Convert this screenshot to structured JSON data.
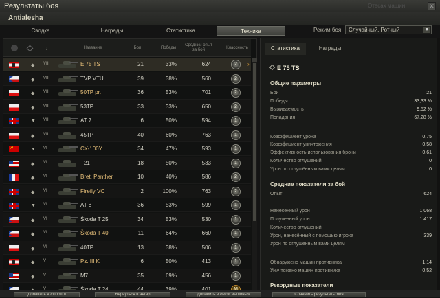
{
  "window": {
    "title": "Результаты боя",
    "close_glyph": "✕",
    "ghost_text": "Отесах машин"
  },
  "user": {
    "name": "Antialesha"
  },
  "tabs": [
    {
      "label": "Сводка"
    },
    {
      "label": "Награды"
    },
    {
      "label": "Статистика"
    },
    {
      "label": "Техника",
      "active": true
    }
  ],
  "mode": {
    "label": "Режим боя:",
    "value": "Случайный, Ротный",
    "arrow": "▼"
  },
  "table": {
    "headers": {
      "name": "Название",
      "battles": "Бои",
      "wins": "Победы",
      "avg_exp": "Средний опыт за бой",
      "mastery": "Классность"
    },
    "rows": [
      {
        "flag": "de",
        "cls": "◆",
        "tier": "VIII",
        "name": "E 75 TS",
        "gold": true,
        "battles": "21",
        "wins": "33%",
        "exp": "624",
        "mastery": "2",
        "mclass": "",
        "selected": true
      },
      {
        "flag": "cz",
        "cls": "◆",
        "tier": "VIII",
        "name": "TVP VTU",
        "gold": false,
        "battles": "39",
        "wins": "38%",
        "exp": "560",
        "mastery": "2",
        "mclass": ""
      },
      {
        "flag": "pl",
        "cls": "◆",
        "tier": "VIII",
        "name": "50TP pr.",
        "gold": true,
        "battles": "36",
        "wins": "53%",
        "exp": "701",
        "mastery": "2",
        "mclass": ""
      },
      {
        "flag": "pl",
        "cls": "◆",
        "tier": "VIII",
        "name": "53TP",
        "gold": false,
        "battles": "33",
        "wins": "33%",
        "exp": "650",
        "mastery": "2",
        "mclass": ""
      },
      {
        "flag": "gb",
        "cls": "▼",
        "tier": "VIII",
        "name": "AT 7",
        "gold": false,
        "battles": "6",
        "wins": "50%",
        "exp": "594",
        "mastery": "1",
        "mclass": ""
      },
      {
        "flag": "pl",
        "cls": "◆",
        "tier": "VII",
        "name": "45TP",
        "gold": false,
        "battles": "40",
        "wins": "60%",
        "exp": "763",
        "mastery": "1",
        "mclass": ""
      },
      {
        "flag": "su",
        "cls": "▼",
        "tier": "VI",
        "name": "СУ-100Y",
        "gold": true,
        "battles": "34",
        "wins": "47%",
        "exp": "593",
        "mastery": "1",
        "mclass": ""
      },
      {
        "flag": "us",
        "cls": "◆",
        "tier": "VI",
        "name": "T21",
        "gold": false,
        "battles": "18",
        "wins": "50%",
        "exp": "533",
        "mastery": "1",
        "mclass": ""
      },
      {
        "flag": "fr",
        "cls": "◆",
        "tier": "VI",
        "name": "Bret. Panther",
        "gold": true,
        "battles": "10",
        "wins": "40%",
        "exp": "586",
        "mastery": "2",
        "mclass": ""
      },
      {
        "flag": "gb",
        "cls": "◆",
        "tier": "VI",
        "name": "Firefly VC",
        "gold": true,
        "battles": "2",
        "wins": "100%",
        "exp": "763",
        "mastery": "2",
        "mclass": ""
      },
      {
        "flag": "gb",
        "cls": "▼",
        "tier": "VI",
        "name": "AT 8",
        "gold": false,
        "battles": "36",
        "wins": "53%",
        "exp": "599",
        "mastery": "1",
        "mclass": ""
      },
      {
        "flag": "cz",
        "cls": "◆",
        "tier": "VI",
        "name": "Škoda T 25",
        "gold": false,
        "battles": "34",
        "wins": "53%",
        "exp": "530",
        "mastery": "1",
        "mclass": ""
      },
      {
        "flag": "cz",
        "cls": "◆",
        "tier": "VI",
        "name": "Škoda T 40",
        "gold": true,
        "battles": "11",
        "wins": "64%",
        "exp": "660",
        "mastery": "1",
        "mclass": ""
      },
      {
        "flag": "pl",
        "cls": "◆",
        "tier": "VI",
        "name": "40TP",
        "gold": false,
        "battles": "13",
        "wins": "38%",
        "exp": "506",
        "mastery": "1",
        "mclass": ""
      },
      {
        "flag": "de",
        "cls": "◆",
        "tier": "V",
        "name": "Pz. III K",
        "gold": true,
        "battles": "6",
        "wins": "50%",
        "exp": "413",
        "mastery": "1",
        "mclass": ""
      },
      {
        "flag": "us",
        "cls": "◆",
        "tier": "V",
        "name": "M7",
        "gold": false,
        "battles": "35",
        "wins": "69%",
        "exp": "456",
        "mastery": "1",
        "mclass": ""
      },
      {
        "flag": "cz",
        "cls": "◆",
        "tier": "V",
        "name": "Škoda T 24",
        "gold": false,
        "battles": "44",
        "wins": "39%",
        "exp": "401",
        "mastery": "M",
        "mclass": "gold"
      }
    ],
    "selected_arrow": "›"
  },
  "buttons": [
    "Добавить в «Прошл",
    "Вернуться в ангар",
    "Добавить в «Мои машины»",
    "Сравнить результаты боя"
  ],
  "details": {
    "tabs": [
      {
        "label": "Статистика",
        "active": true
      },
      {
        "label": "Награды"
      }
    ],
    "tank_name": "E 75 TS",
    "general_title": "Общие параметры",
    "general": [
      {
        "label": "Бои",
        "value": "21"
      },
      {
        "label": "Победы",
        "value": "33,33 %"
      },
      {
        "label": "Выживаемость",
        "value": "9,52 %"
      },
      {
        "label": "Попадания",
        "value": "67,28 %"
      }
    ],
    "ratios": [
      {
        "label": "Коэффициент урона",
        "value": "0,75"
      },
      {
        "label": "Коэффициент уничтожения",
        "value": "0,58"
      },
      {
        "label": "Эффективность использования брони",
        "value": "0,61"
      },
      {
        "label": "Количество оглушений",
        "value": "0"
      },
      {
        "label": "Урон по оглушённым вами целям",
        "value": "0"
      }
    ],
    "avg_title": "Средние показатели за бой",
    "avg_exp": {
      "label": "Опыт",
      "value": "624"
    },
    "avg": [
      {
        "label": "Нанесённый урон",
        "value": "1 068"
      },
      {
        "label": "Полученный урон",
        "value": "1 417"
      },
      {
        "label": "Количество оглушений",
        "value": ""
      },
      {
        "label": "Урон, нанесённый с помощью игрока",
        "value": "339"
      },
      {
        "label": "Урон по оглушённым вами целям",
        "value": "–"
      }
    ],
    "detect": [
      {
        "label": "Обнаружено машин противника",
        "value": "1,14"
      },
      {
        "label": "Уничтожено машин противника",
        "value": "0,52"
      }
    ],
    "records_title": "Рекордные показатели"
  },
  "icons": {
    "col1": "globe-icon",
    "col2": "tank-class-icon",
    "col3": "sort-icon"
  }
}
